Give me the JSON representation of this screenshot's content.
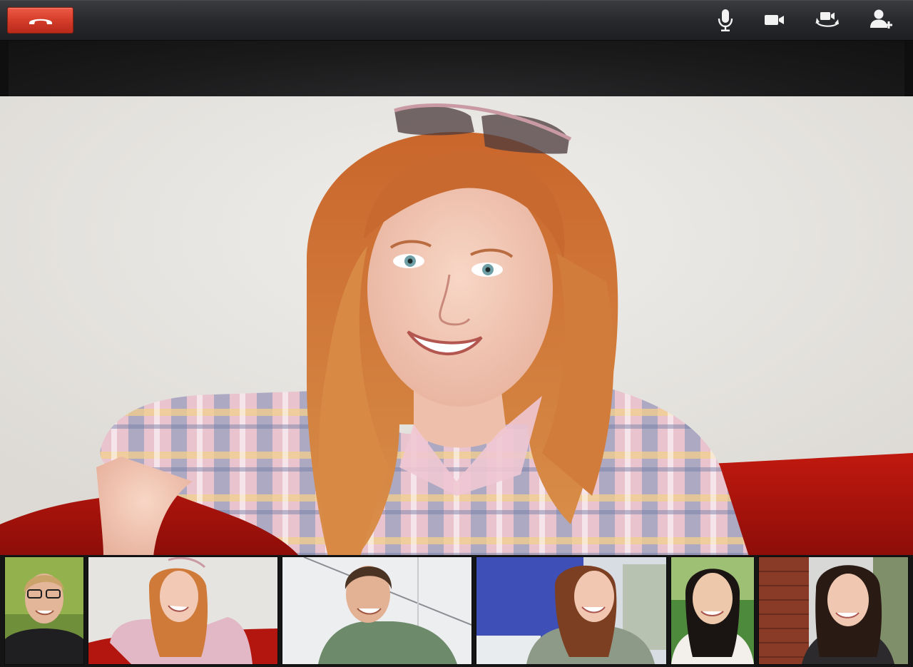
{
  "toolbar": {
    "hangup": {
      "icon": "phone-hangup-icon",
      "color": "#d94a36"
    },
    "buttons": [
      {
        "id": "mic",
        "icon": "microphone-icon"
      },
      {
        "id": "camera",
        "icon": "video-camera-icon"
      },
      {
        "id": "switch-camera",
        "icon": "switch-camera-icon"
      },
      {
        "id": "invite",
        "icon": "add-person-icon"
      }
    ]
  },
  "main_video": {
    "participant_icon": "participant-video"
  },
  "thumbnails": [
    {
      "icon": "participant-video"
    },
    {
      "icon": "participant-video"
    },
    {
      "icon": "participant-video"
    },
    {
      "icon": "participant-video"
    },
    {
      "icon": "participant-video"
    },
    {
      "icon": "participant-video"
    }
  ],
  "colors": {
    "hangup_red": "#d94a36",
    "toolbar_bg": "#2a2c30",
    "icon_white": "#f2f2f2",
    "couch_red": "#b3150f"
  }
}
